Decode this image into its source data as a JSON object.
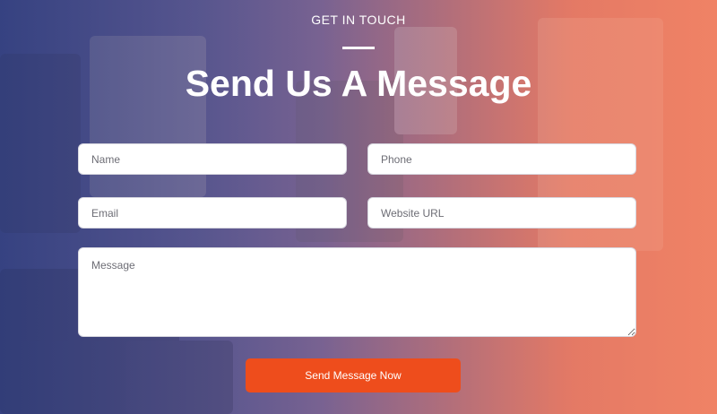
{
  "section": {
    "eyebrow": "GET IN TOUCH",
    "title": "Send Us A Message"
  },
  "form": {
    "name_placeholder": "Name",
    "phone_placeholder": "Phone",
    "email_placeholder": "Email",
    "website_placeholder": "Website URL",
    "message_placeholder": "Message",
    "submit_label": "Send Message Now"
  },
  "colors": {
    "accent": "#ee4d1c",
    "gradient_left": "#3e4a86",
    "gradient_right": "#ef8a6a"
  }
}
